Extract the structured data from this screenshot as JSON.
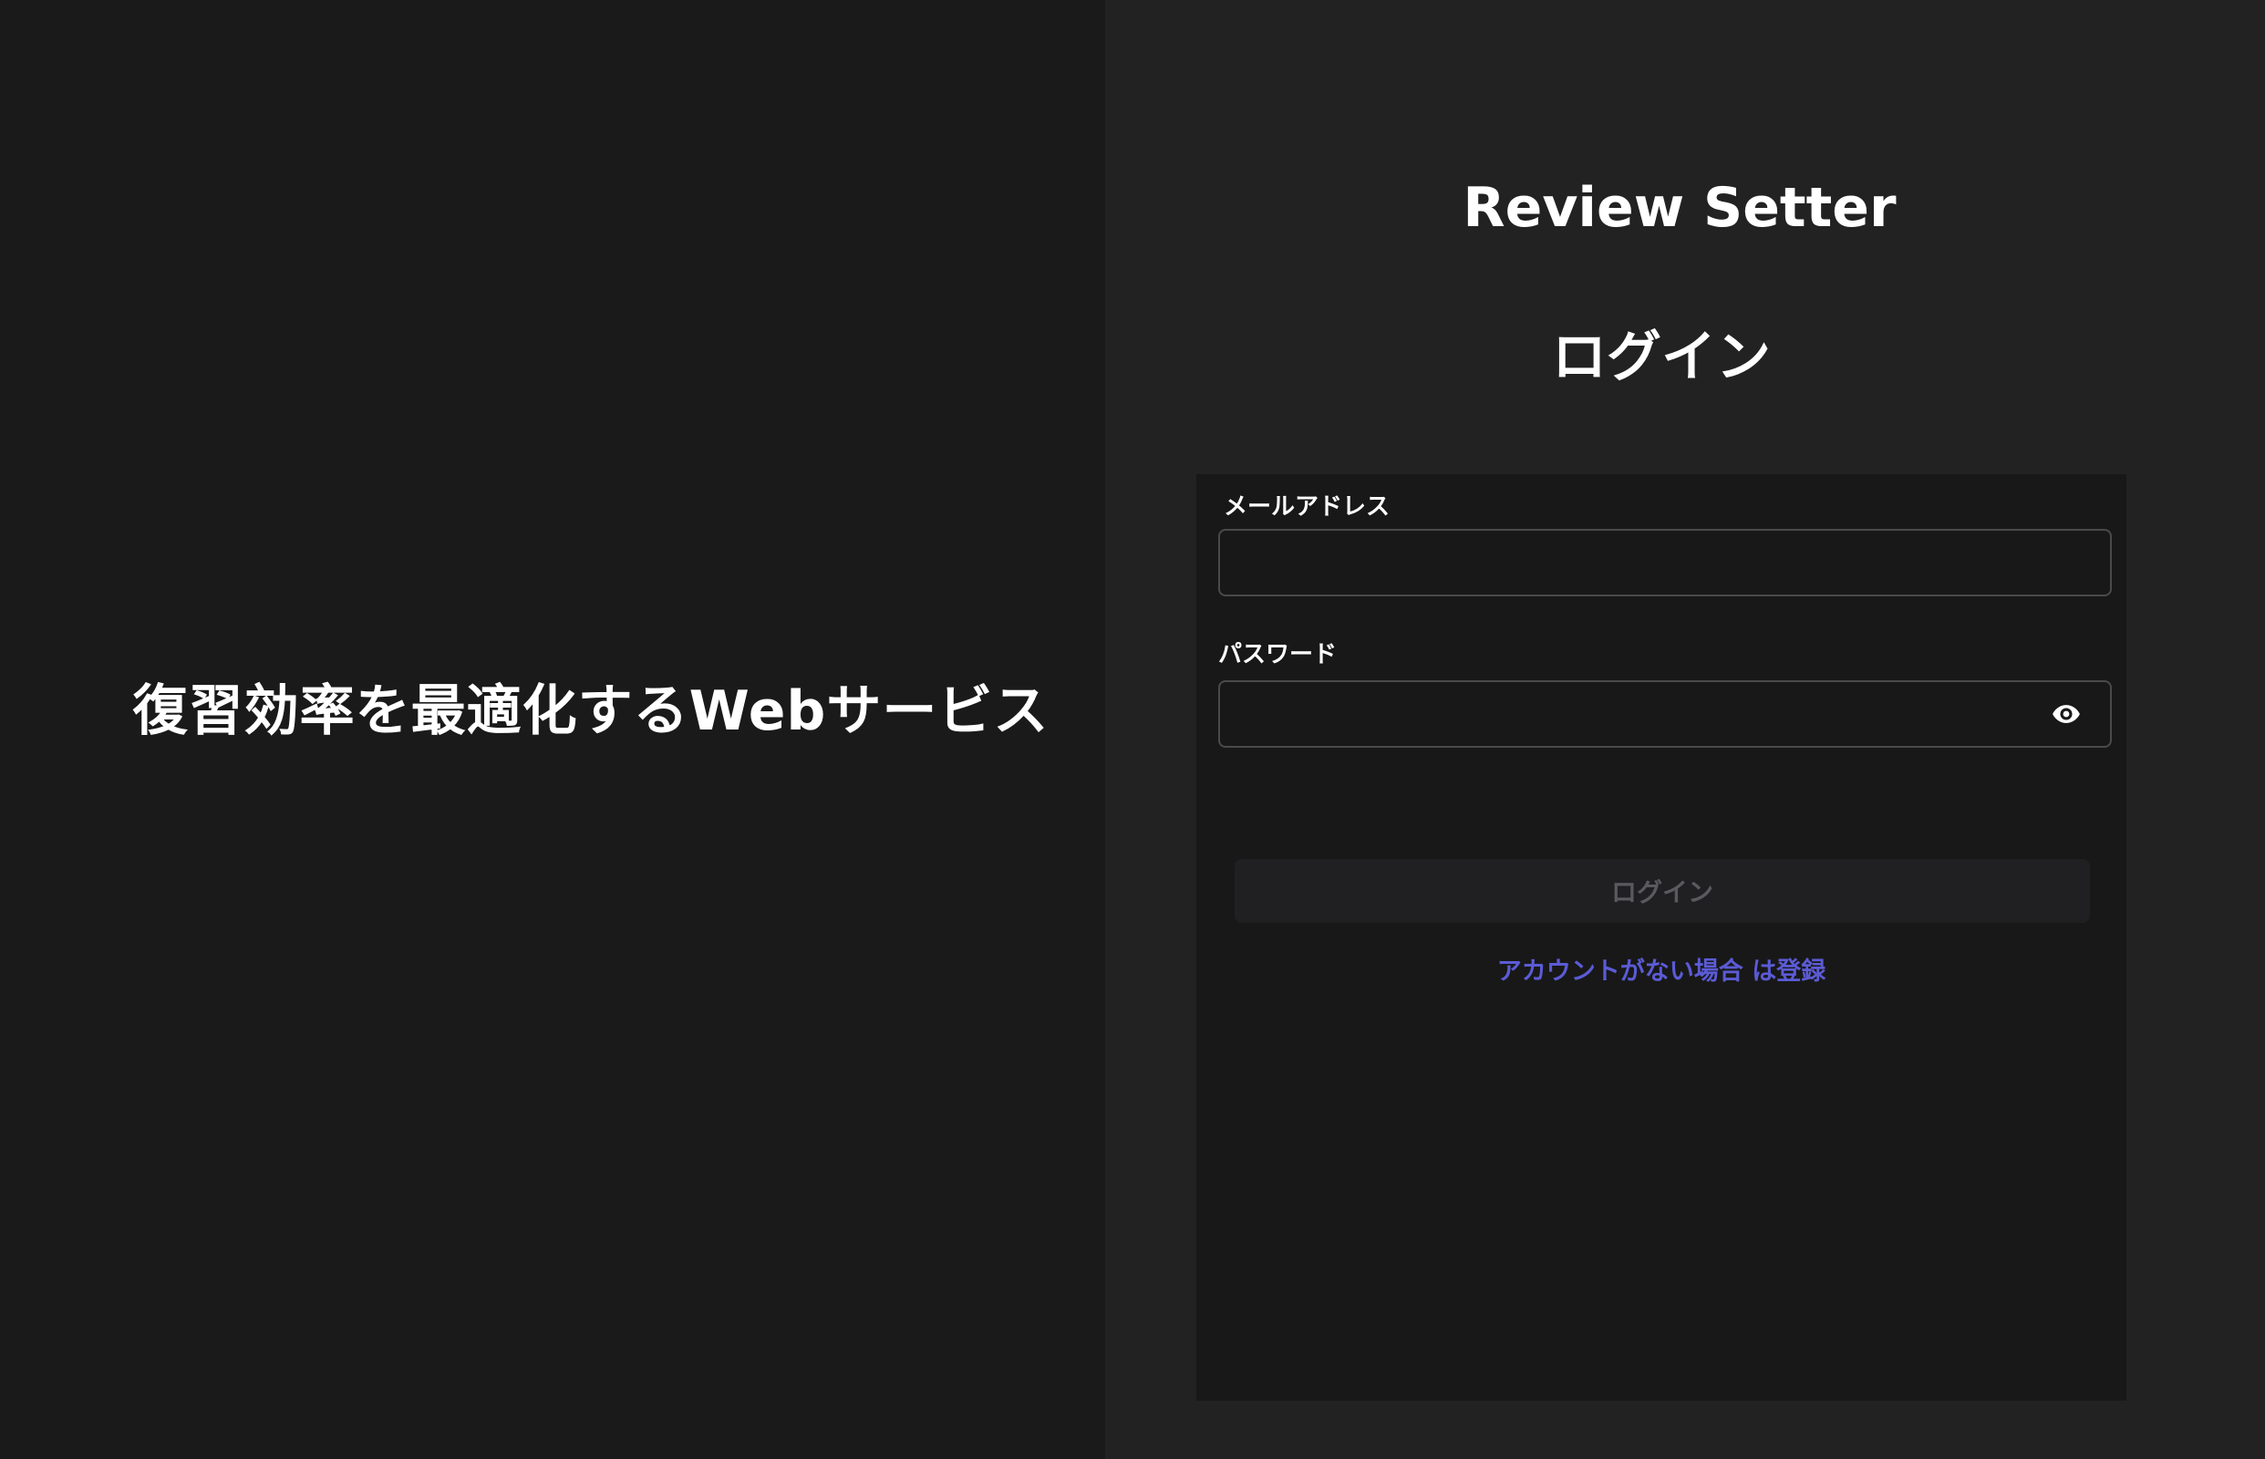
{
  "hero": {
    "tagline": "復習効率を最適化するWebサービス"
  },
  "header": {
    "app_title": "Review Setter",
    "page_heading": "ログイン"
  },
  "form": {
    "email_label": "メールアドレス",
    "email_value": "",
    "password_label": "パスワード",
    "password_value": "",
    "password_toggle_icon": "eye-icon",
    "submit_label": "ログイン",
    "register_link": "アカウントがない場合 は登録"
  },
  "colors": {
    "left_background": "#1a1a1a",
    "right_background": "#222222",
    "card_background": "#181818",
    "link_color": "#5b5bd6",
    "disabled_button_text": "#5a5a5e"
  }
}
